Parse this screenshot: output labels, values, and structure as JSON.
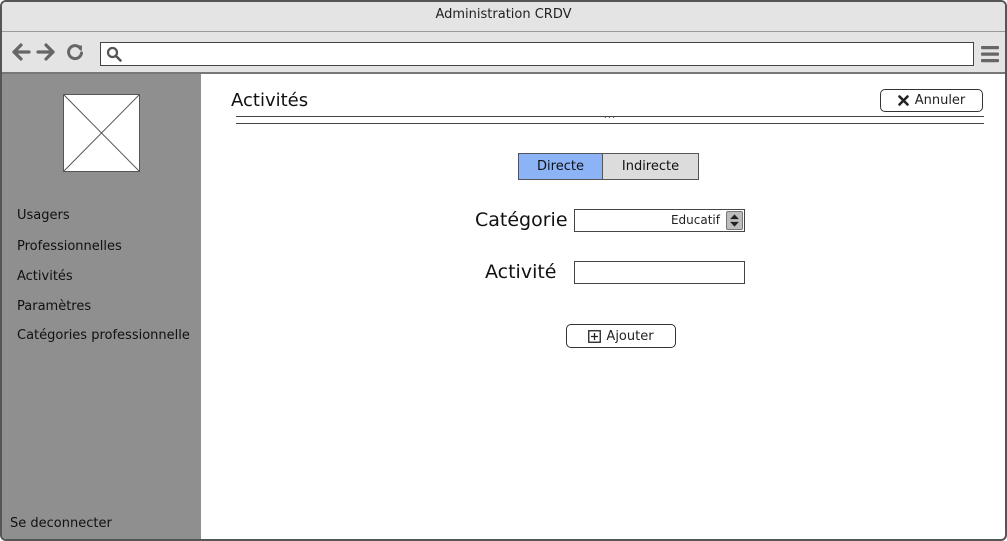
{
  "window": {
    "title": "Administration CRDV"
  },
  "browser": {
    "url_value": "",
    "icons": [
      "back-arrow-icon",
      "forward-arrow-icon",
      "reload-icon",
      "search-icon",
      "hamburger-menu-icon"
    ]
  },
  "sidebar": {
    "items": [
      {
        "label": "Usagers"
      },
      {
        "label": "Professionnelles"
      },
      {
        "label": "Activités"
      },
      {
        "label": "Paramètres"
      },
      {
        "label": "Catégories professionnelle"
      }
    ],
    "logout_label": "Se deconnecter"
  },
  "main": {
    "title": "Activités",
    "cancel_label": "Annuler",
    "divider_dots": "...",
    "segment": {
      "options": [
        "Directe",
        "Indirecte"
      ],
      "selected": "Directe"
    },
    "category": {
      "label": "Catégorie",
      "value": "Educatif"
    },
    "activity": {
      "label": "Activité",
      "value": ""
    },
    "add_label": "Ajouter"
  },
  "colors": {
    "sidebar_bg": "#8f8f8f",
    "toolbar_bg": "#e4e4e4",
    "segment_active": "#8cb3f5",
    "segment_inactive": "#dcdcdc"
  }
}
